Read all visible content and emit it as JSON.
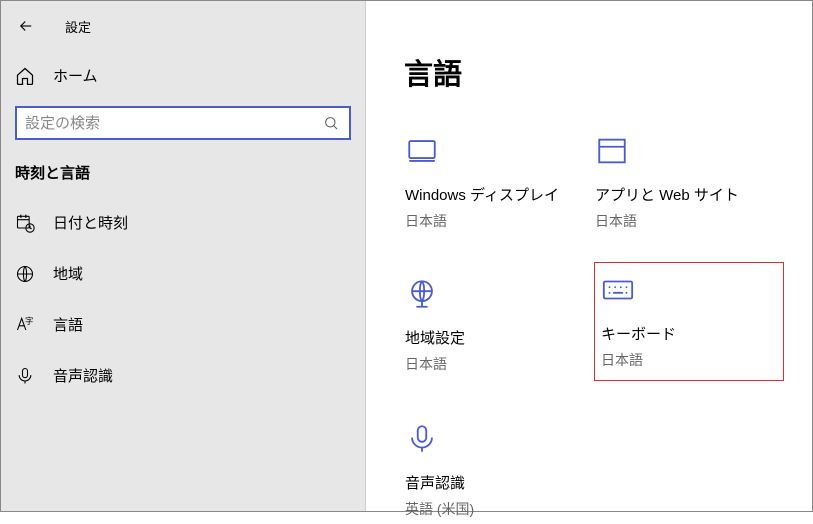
{
  "header": {
    "title": "設定"
  },
  "sidebar": {
    "home_label": "ホーム",
    "search_placeholder": "設定の検索",
    "section_title": "時刻と言語",
    "items": [
      {
        "label": "日付と時刻"
      },
      {
        "label": "地域"
      },
      {
        "label": "言語"
      },
      {
        "label": "音声認識"
      }
    ]
  },
  "main": {
    "title": "言語",
    "tiles": [
      {
        "title": "Windows ディスプレイ",
        "sub": "日本語"
      },
      {
        "title": "アプリと Web サイト",
        "sub": "日本語"
      },
      {
        "title": "地域設定",
        "sub": "日本語"
      },
      {
        "title": "キーボード",
        "sub": "日本語"
      },
      {
        "title": "音声認識",
        "sub": "英語 (米国)"
      }
    ]
  }
}
